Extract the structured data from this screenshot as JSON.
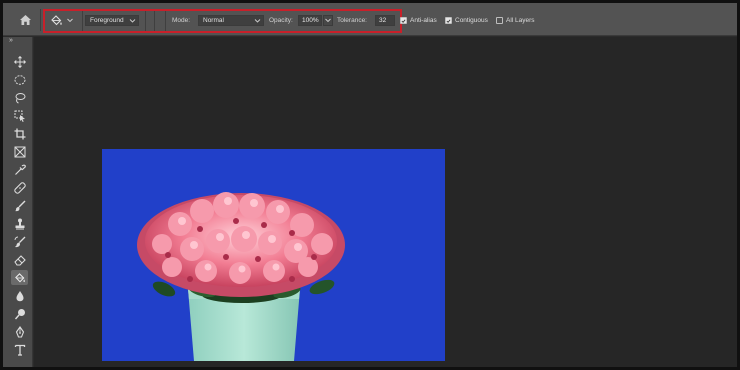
{
  "options_bar": {
    "preset_icon": "paint-bucket-icon",
    "fill_source": {
      "value": "Foreground"
    },
    "mode": {
      "label": "Mode:",
      "value": "Normal"
    },
    "opacity": {
      "label": "Opacity:",
      "value": "100%"
    },
    "tolerance": {
      "label": "Tolerance:",
      "value": "32"
    },
    "anti_alias": {
      "label": "Anti-alias",
      "checked": true
    },
    "contiguous": {
      "label": "Contiguous",
      "checked": true
    },
    "all_layers": {
      "label": "All Layers",
      "checked": false
    },
    "highlight_color": "#c8202a"
  },
  "toolbar": {
    "collapse_label": "»",
    "tools": [
      {
        "name": "move-tool",
        "icon": "move-icon",
        "active": false
      },
      {
        "name": "elliptical-marquee-tool",
        "icon": "ellipse-marquee-icon",
        "active": false
      },
      {
        "name": "lasso-tool",
        "icon": "lasso-icon",
        "active": false
      },
      {
        "name": "object-selection-tool",
        "icon": "object-selection-icon",
        "active": false
      },
      {
        "name": "crop-tool",
        "icon": "crop-icon",
        "active": false
      },
      {
        "name": "frame-tool",
        "icon": "frame-icon",
        "active": false
      },
      {
        "name": "eyedropper-tool",
        "icon": "eyedropper-icon",
        "active": false
      },
      {
        "name": "healing-brush-tool",
        "icon": "bandage-icon",
        "active": false
      },
      {
        "name": "brush-tool",
        "icon": "brush-icon",
        "active": false
      },
      {
        "name": "clone-stamp-tool",
        "icon": "stamp-icon",
        "active": false
      },
      {
        "name": "history-brush-tool",
        "icon": "history-brush-icon",
        "active": false
      },
      {
        "name": "eraser-tool",
        "icon": "eraser-icon",
        "active": false
      },
      {
        "name": "paint-bucket-tool",
        "icon": "paint-bucket-icon",
        "active": true
      },
      {
        "name": "blur-tool",
        "icon": "droplet-icon",
        "active": false
      },
      {
        "name": "dodge-tool",
        "icon": "dodge-icon",
        "active": false
      },
      {
        "name": "pen-tool",
        "icon": "pen-icon",
        "active": false
      },
      {
        "name": "type-tool",
        "icon": "type-icon",
        "active": false
      }
    ]
  },
  "canvas": {
    "background_color": "#2140c9",
    "image": "flower-pot-photo"
  }
}
